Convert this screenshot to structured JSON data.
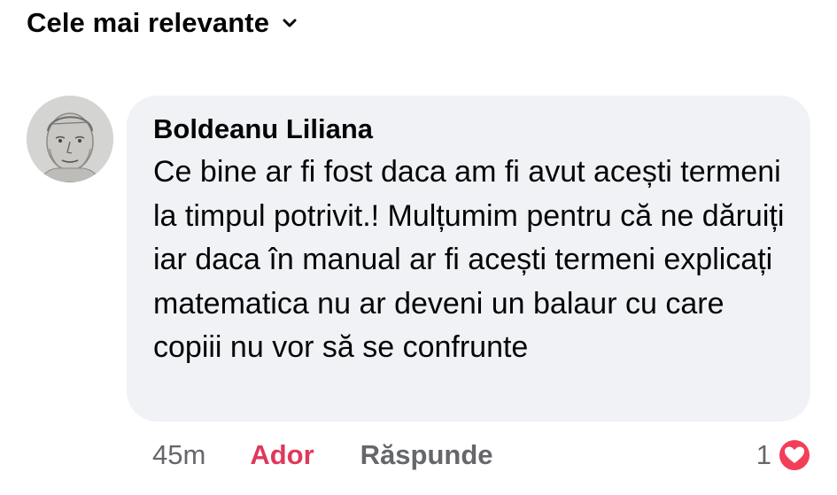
{
  "sort": {
    "label": "Cele mai relevante",
    "icon": "chevron-down-icon"
  },
  "comment": {
    "author": "Boldeanu Liliana",
    "text": "Ce bine ar fi fost daca am fi avut acești termeni la timpul potrivit.! Mulțumim pentru că ne dăruiți iar daca în manual ar fi acești termeni explicați matematica nu ar deveni un balaur cu care copiii nu vor să se confrunte",
    "time": "45m",
    "like_label": "Ador",
    "reply_label": "Răspunde",
    "reaction_count": "1",
    "reaction_icon": "love-reaction-icon"
  },
  "colors": {
    "bubble": "#f0f2f5",
    "like_active": "#e0385a",
    "muted": "#65676b",
    "love": "#f33e58"
  }
}
